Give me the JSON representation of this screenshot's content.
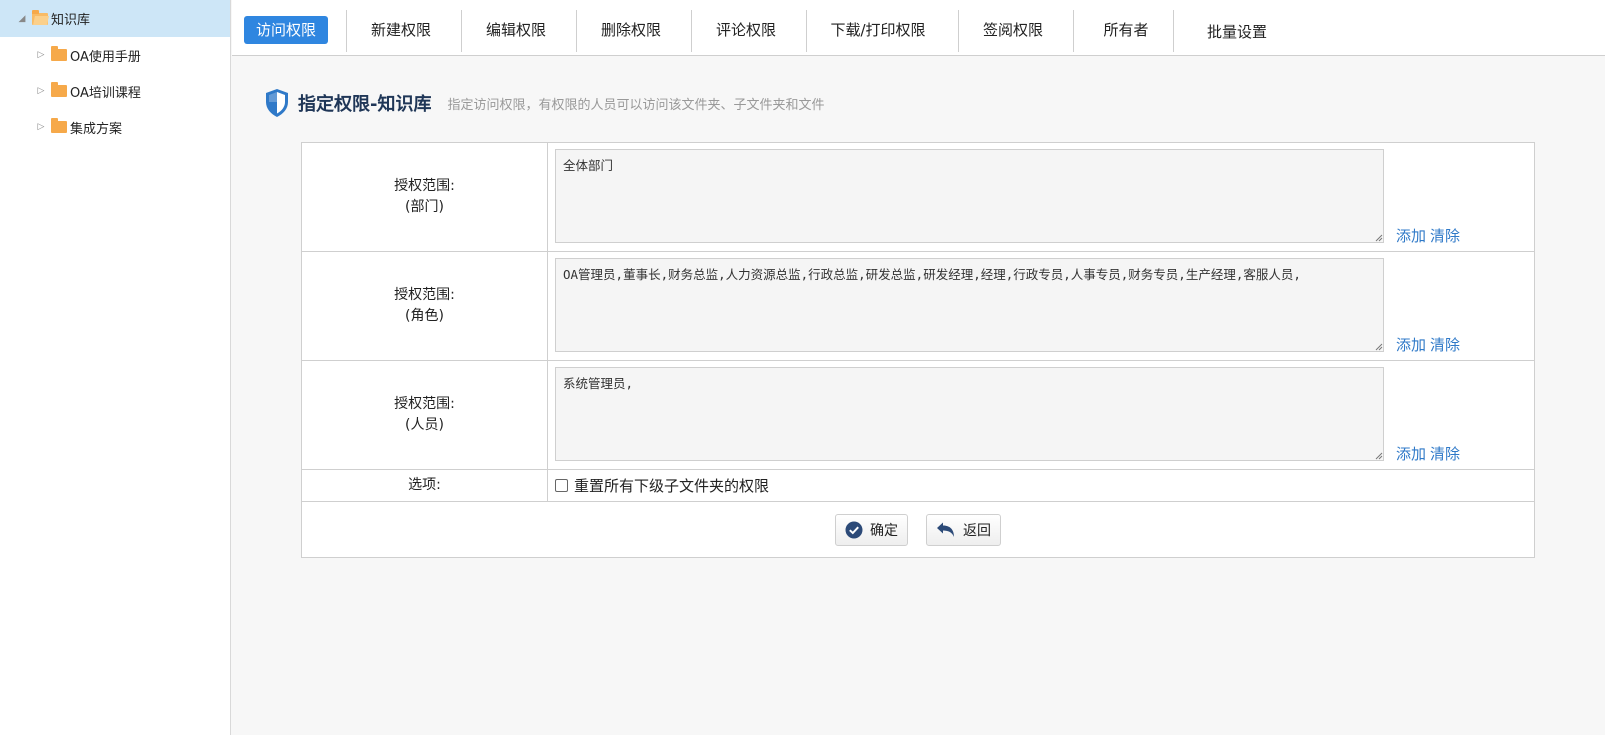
{
  "sidebar": {
    "root": {
      "label": "知识库"
    },
    "children": [
      {
        "label": "OA使用手册"
      },
      {
        "label": "OA培训课程"
      },
      {
        "label": "集成方案"
      }
    ]
  },
  "tabs": [
    {
      "label": "访问权限",
      "active": true
    },
    {
      "label": "新建权限"
    },
    {
      "label": "编辑权限"
    },
    {
      "label": "删除权限"
    },
    {
      "label": "评论权限"
    },
    {
      "label": "下载/打印权限"
    },
    {
      "label": "签阅权限"
    },
    {
      "label": "所有者"
    },
    {
      "label": "批量设置"
    }
  ],
  "header": {
    "title": "指定权限-知识库",
    "description": "指定访问权限，有权限的人员可以访问该文件夹、子文件夹和文件"
  },
  "form": {
    "rows": [
      {
        "label_line1": "授权范围:",
        "label_line2": "(部门)",
        "value": "全体部门",
        "add": "添加",
        "clear": "清除"
      },
      {
        "label_line1": "授权范围:",
        "label_line2": "(角色)",
        "value": "OA管理员,董事长,财务总监,人力资源总监,行政总监,研发总监,研发经理,经理,行政专员,人事专员,财务专员,生产经理,客服人员,",
        "add": "添加",
        "clear": "清除"
      },
      {
        "label_line1": "授权范围:",
        "label_line2": "(人员)",
        "value": "系统管理员,",
        "add": "添加",
        "clear": "清除"
      }
    ],
    "option_label": "选项:",
    "option_checkbox_label": "重置所有下级子文件夹的权限",
    "confirm_label": "确定",
    "back_label": "返回"
  },
  "colors": {
    "accent": "#2f86e0",
    "link": "#2f79c8",
    "title": "#1f3657",
    "folder": "#f6a94a"
  }
}
